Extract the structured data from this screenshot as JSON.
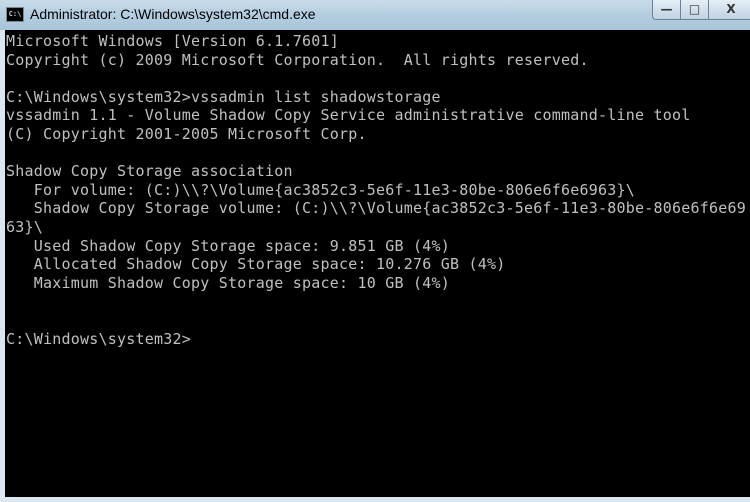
{
  "window": {
    "title": "Administrator: C:\\Windows\\system32\\cmd.exe",
    "icon": "cmd-icon",
    "controls": {
      "minimize": "minimize-icon",
      "maximize": "maximize-icon",
      "close": "close-icon"
    }
  },
  "console": {
    "lines": [
      "Microsoft Windows [Version 6.1.7601]",
      "Copyright (c) 2009 Microsoft Corporation.  All rights reserved.",
      "",
      "C:\\Windows\\system32>vssadmin list shadowstorage",
      "vssadmin 1.1 - Volume Shadow Copy Service administrative command-line tool",
      "(C) Copyright 2001-2005 Microsoft Corp.",
      "",
      "Shadow Copy Storage association",
      "   For volume: (C:)\\\\?\\Volume{ac3852c3-5e6f-11e3-80be-806e6f6e6963}\\",
      "   Shadow Copy Storage volume: (C:)\\\\?\\Volume{ac3852c3-5e6f-11e3-80be-806e6f6e69",
      "63}\\",
      "   Used Shadow Copy Storage space: 9.851 GB (4%)",
      "   Allocated Shadow Copy Storage space: 10.276 GB (4%)",
      "   Maximum Shadow Copy Storage space: 10 GB (4%)",
      "",
      "",
      "C:\\Windows\\system32>"
    ]
  }
}
